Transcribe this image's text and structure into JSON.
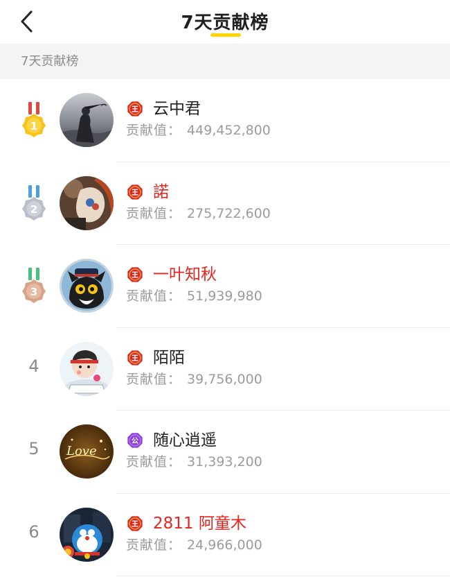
{
  "header": {
    "title": "7天贡献榜",
    "back_icon": "chevron-left-icon",
    "accent_color": "#ffd400"
  },
  "section": {
    "title": "7天贡献榜"
  },
  "score_label": "贡献值：",
  "entries": [
    {
      "rank": "1",
      "medal": "gold",
      "badge": "王",
      "badge_type": "king",
      "name": "云中君",
      "name_color": "#222222",
      "score": "449,452,800"
    },
    {
      "rank": "2",
      "medal": "silver",
      "badge": "王",
      "badge_type": "king",
      "name": "諾",
      "name_color": "#e8231d",
      "score": "275,722,600"
    },
    {
      "rank": "3",
      "medal": "bronze",
      "badge": "王",
      "badge_type": "king",
      "name": "一叶知秋",
      "name_color": "#e8231d",
      "score": "51,939,980"
    },
    {
      "rank": "4",
      "medal": "",
      "badge": "王",
      "badge_type": "king",
      "name": "陌陌",
      "name_color": "#222222",
      "score": "39,756,000"
    },
    {
      "rank": "5",
      "medal": "",
      "badge": "公",
      "badge_type": "duke",
      "name": "随心逍遥",
      "name_color": "#222222",
      "score": "31,393,200"
    },
    {
      "rank": "6",
      "medal": "",
      "badge": "王",
      "badge_type": "king",
      "name": "2811 阿童木",
      "name_color": "#e8231d",
      "score": "24,966,000"
    }
  ]
}
